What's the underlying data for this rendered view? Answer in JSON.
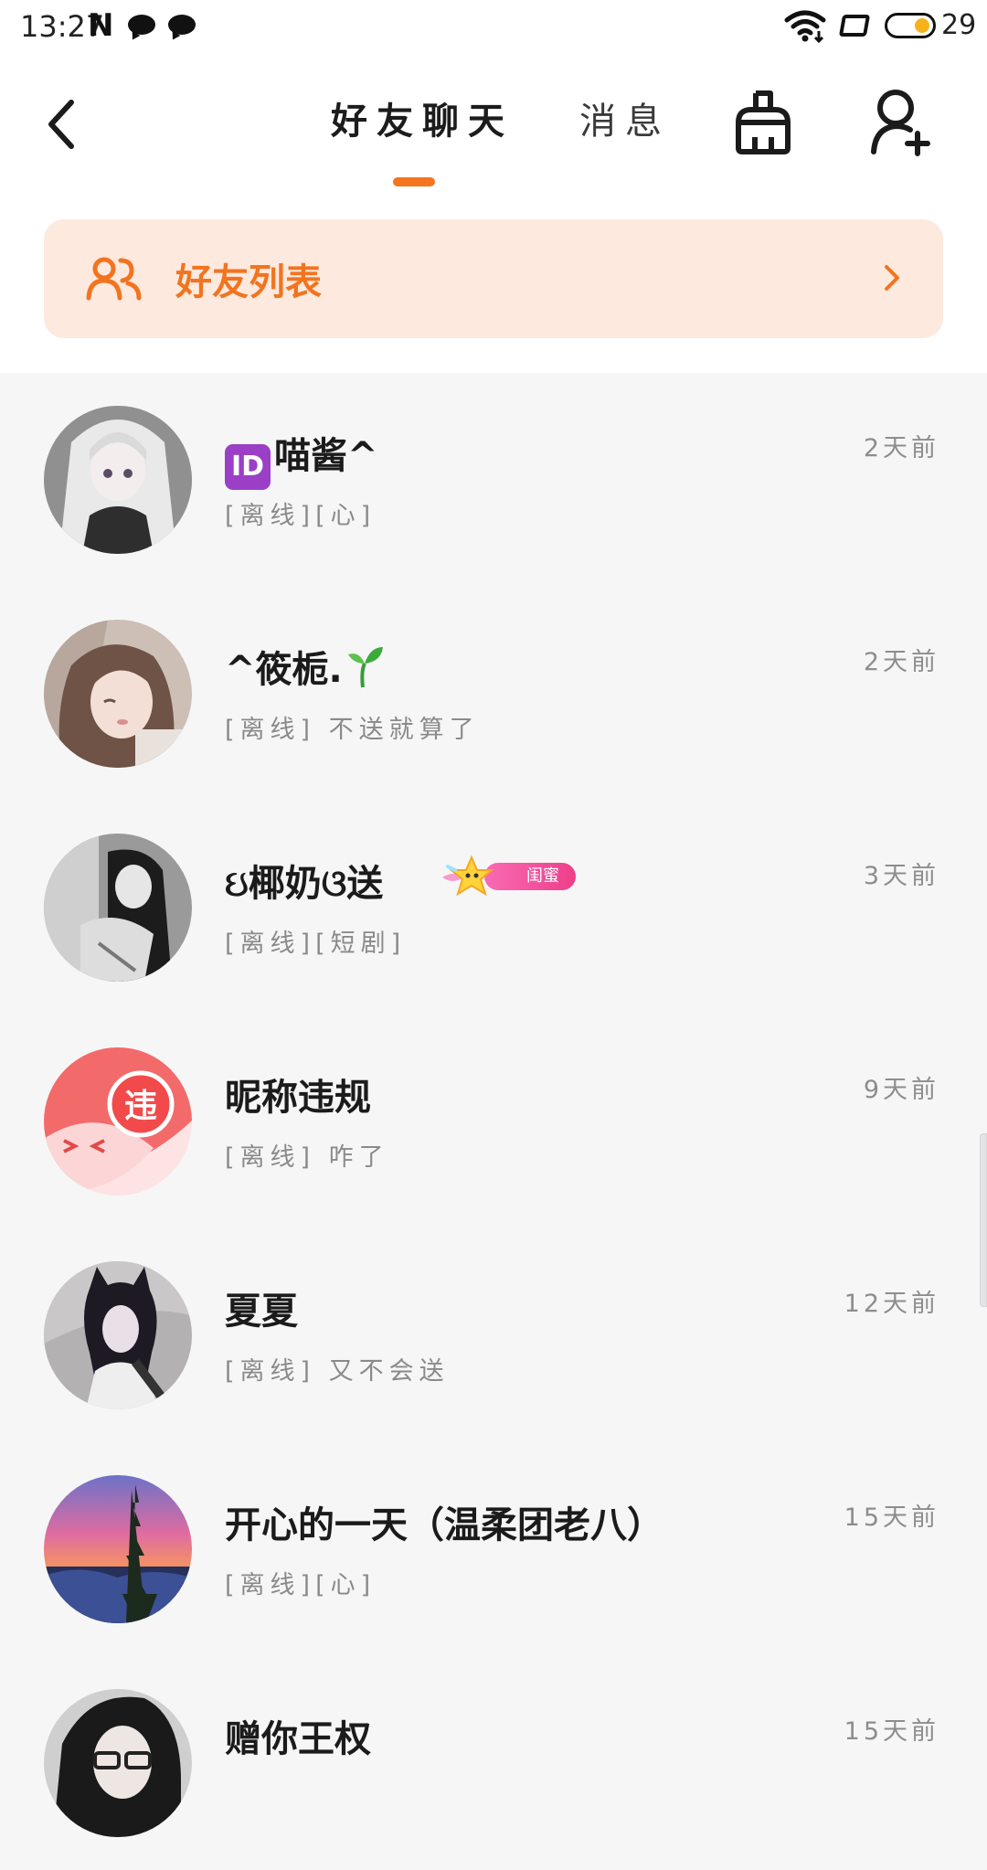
{
  "status_bar": {
    "time": "13:27",
    "n_logo": "N",
    "battery": "29"
  },
  "header": {
    "tabs": [
      {
        "label": "好友聊天",
        "active": true
      },
      {
        "label": "消息",
        "active": false
      }
    ],
    "accent": "#f5741e"
  },
  "banner": {
    "label": "好友列表",
    "background": "#fee9de",
    "color": "#f27420"
  },
  "chats": [
    {
      "name": "喵酱^",
      "badge": "ID",
      "preview": "[离线][心]",
      "time": "2天前",
      "avatar": "anime-girl-gray"
    },
    {
      "name": "^筱栀.",
      "preview": "[离线] 不送就算了",
      "time": "2天前",
      "avatar": "girl-portrait"
    },
    {
      "name": "ઇ椰奶ଓ送",
      "vip_label": "闺蜜",
      "preview": "[离线][短剧]",
      "time": "3天前",
      "avatar": "girl-bw"
    },
    {
      "name": "昵称违规",
      "avatar_text": "违",
      "preview": "[离线] 咋了",
      "time": "9天前",
      "avatar": "violation-default"
    },
    {
      "name": "夏夏",
      "preview": "[离线] 又不会送",
      "time": "12天前",
      "avatar": "cat-ear-girl"
    },
    {
      "name": "开心的一天（温柔团老八）",
      "preview": "[离线][心]",
      "time": "15天前",
      "avatar": "sunset-tree"
    },
    {
      "name": "赠你王权",
      "preview": "",
      "time": "15天前",
      "avatar": "glasses-person"
    }
  ]
}
